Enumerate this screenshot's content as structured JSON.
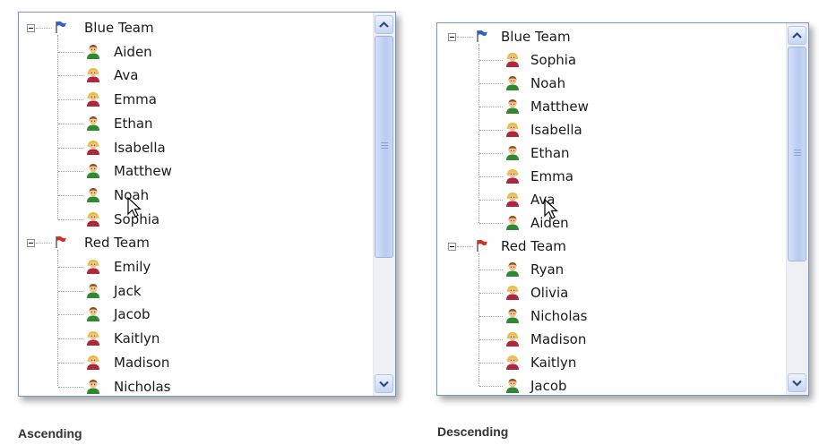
{
  "views": [
    {
      "id": "asc",
      "caption": "Ascending",
      "groups": [
        {
          "label": "Blue Team",
          "flag_color": "#2e63c9",
          "members": [
            {
              "name": "Aiden",
              "gender": "male"
            },
            {
              "name": "Ava",
              "gender": "female"
            },
            {
              "name": "Emma",
              "gender": "female"
            },
            {
              "name": "Ethan",
              "gender": "male"
            },
            {
              "name": "Isabella",
              "gender": "female"
            },
            {
              "name": "Matthew",
              "gender": "male"
            },
            {
              "name": "Noah",
              "gender": "male"
            },
            {
              "name": "Sophia",
              "gender": "female"
            }
          ]
        },
        {
          "label": "Red Team",
          "flag_color": "#d0321e",
          "members": [
            {
              "name": "Emily",
              "gender": "female"
            },
            {
              "name": "Jack",
              "gender": "male"
            },
            {
              "name": "Jacob",
              "gender": "male"
            },
            {
              "name": "Kaitlyn",
              "gender": "female"
            },
            {
              "name": "Madison",
              "gender": "female"
            },
            {
              "name": "Nicholas",
              "gender": "male"
            }
          ]
        }
      ]
    },
    {
      "id": "desc",
      "caption": "Descending",
      "groups": [
        {
          "label": "Blue Team",
          "flag_color": "#2e63c9",
          "members": [
            {
              "name": "Sophia",
              "gender": "female"
            },
            {
              "name": "Noah",
              "gender": "male"
            },
            {
              "name": "Matthew",
              "gender": "male"
            },
            {
              "name": "Isabella",
              "gender": "female"
            },
            {
              "name": "Ethan",
              "gender": "male"
            },
            {
              "name": "Emma",
              "gender": "female"
            },
            {
              "name": "Ava",
              "gender": "female"
            },
            {
              "name": "Aiden",
              "gender": "male"
            }
          ]
        },
        {
          "label": "Red Team",
          "flag_color": "#d0321e",
          "members": [
            {
              "name": "Ryan",
              "gender": "male"
            },
            {
              "name": "Olivia",
              "gender": "female"
            },
            {
              "name": "Nicholas",
              "gender": "male"
            },
            {
              "name": "Madison",
              "gender": "female"
            },
            {
              "name": "Kaitlyn",
              "gender": "female"
            },
            {
              "name": "Jacob",
              "gender": "male"
            }
          ]
        }
      ]
    }
  ],
  "colors": {
    "male_shirt": "#2f8a2f",
    "female_shirt": "#b0263a",
    "skin": "#f2c48d",
    "male_hair": "#8b4a1e",
    "female_hair": "#e8c04a"
  }
}
